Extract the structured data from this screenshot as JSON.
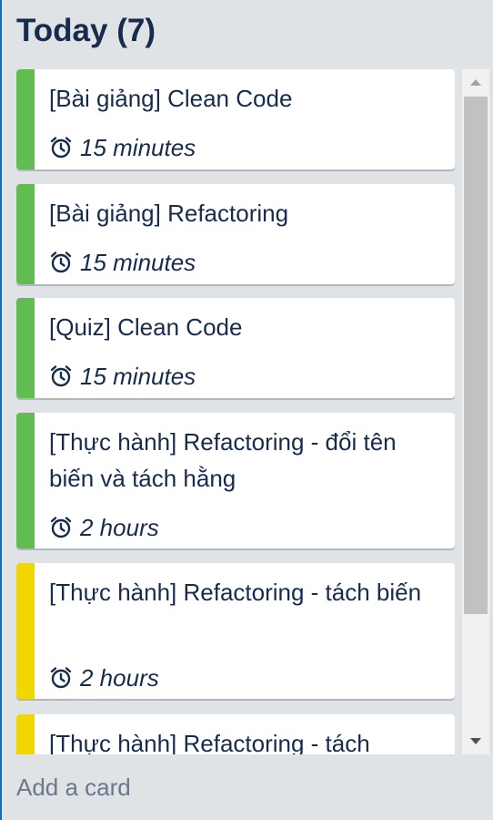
{
  "list": {
    "title": "Today (7)",
    "add_card_label": "Add a card"
  },
  "colors": {
    "green": "#61bd4f",
    "yellow": "#f2d600",
    "text": "#172b4d",
    "muted": "#6b778c"
  },
  "cards": [
    {
      "title": "[Bài giảng] Clean Code",
      "duration": "15 minutes",
      "label_color": "green",
      "icon": "alarm-clock-icon"
    },
    {
      "title": "[Bài giảng] Refactoring",
      "duration": "15 minutes",
      "label_color": "green",
      "icon": "alarm-clock-icon"
    },
    {
      "title": "[Quiz] Clean Code",
      "duration": "15 minutes",
      "label_color": "green",
      "icon": "alarm-clock-icon"
    },
    {
      "title": "[Thực hành] Refactoring - đổi tên biến và tách hằng",
      "duration": "2 hours",
      "label_color": "green",
      "icon": "alarm-clock-icon"
    },
    {
      "title": "[Thực hành] Refactoring - tách biến",
      "duration": "2 hours",
      "label_color": "yellow",
      "icon": "alarm-clock-icon"
    },
    {
      "title": "[Thực hành] Refactoring - tách",
      "duration": "",
      "label_color": "yellow",
      "icon": "alarm-clock-icon"
    }
  ]
}
